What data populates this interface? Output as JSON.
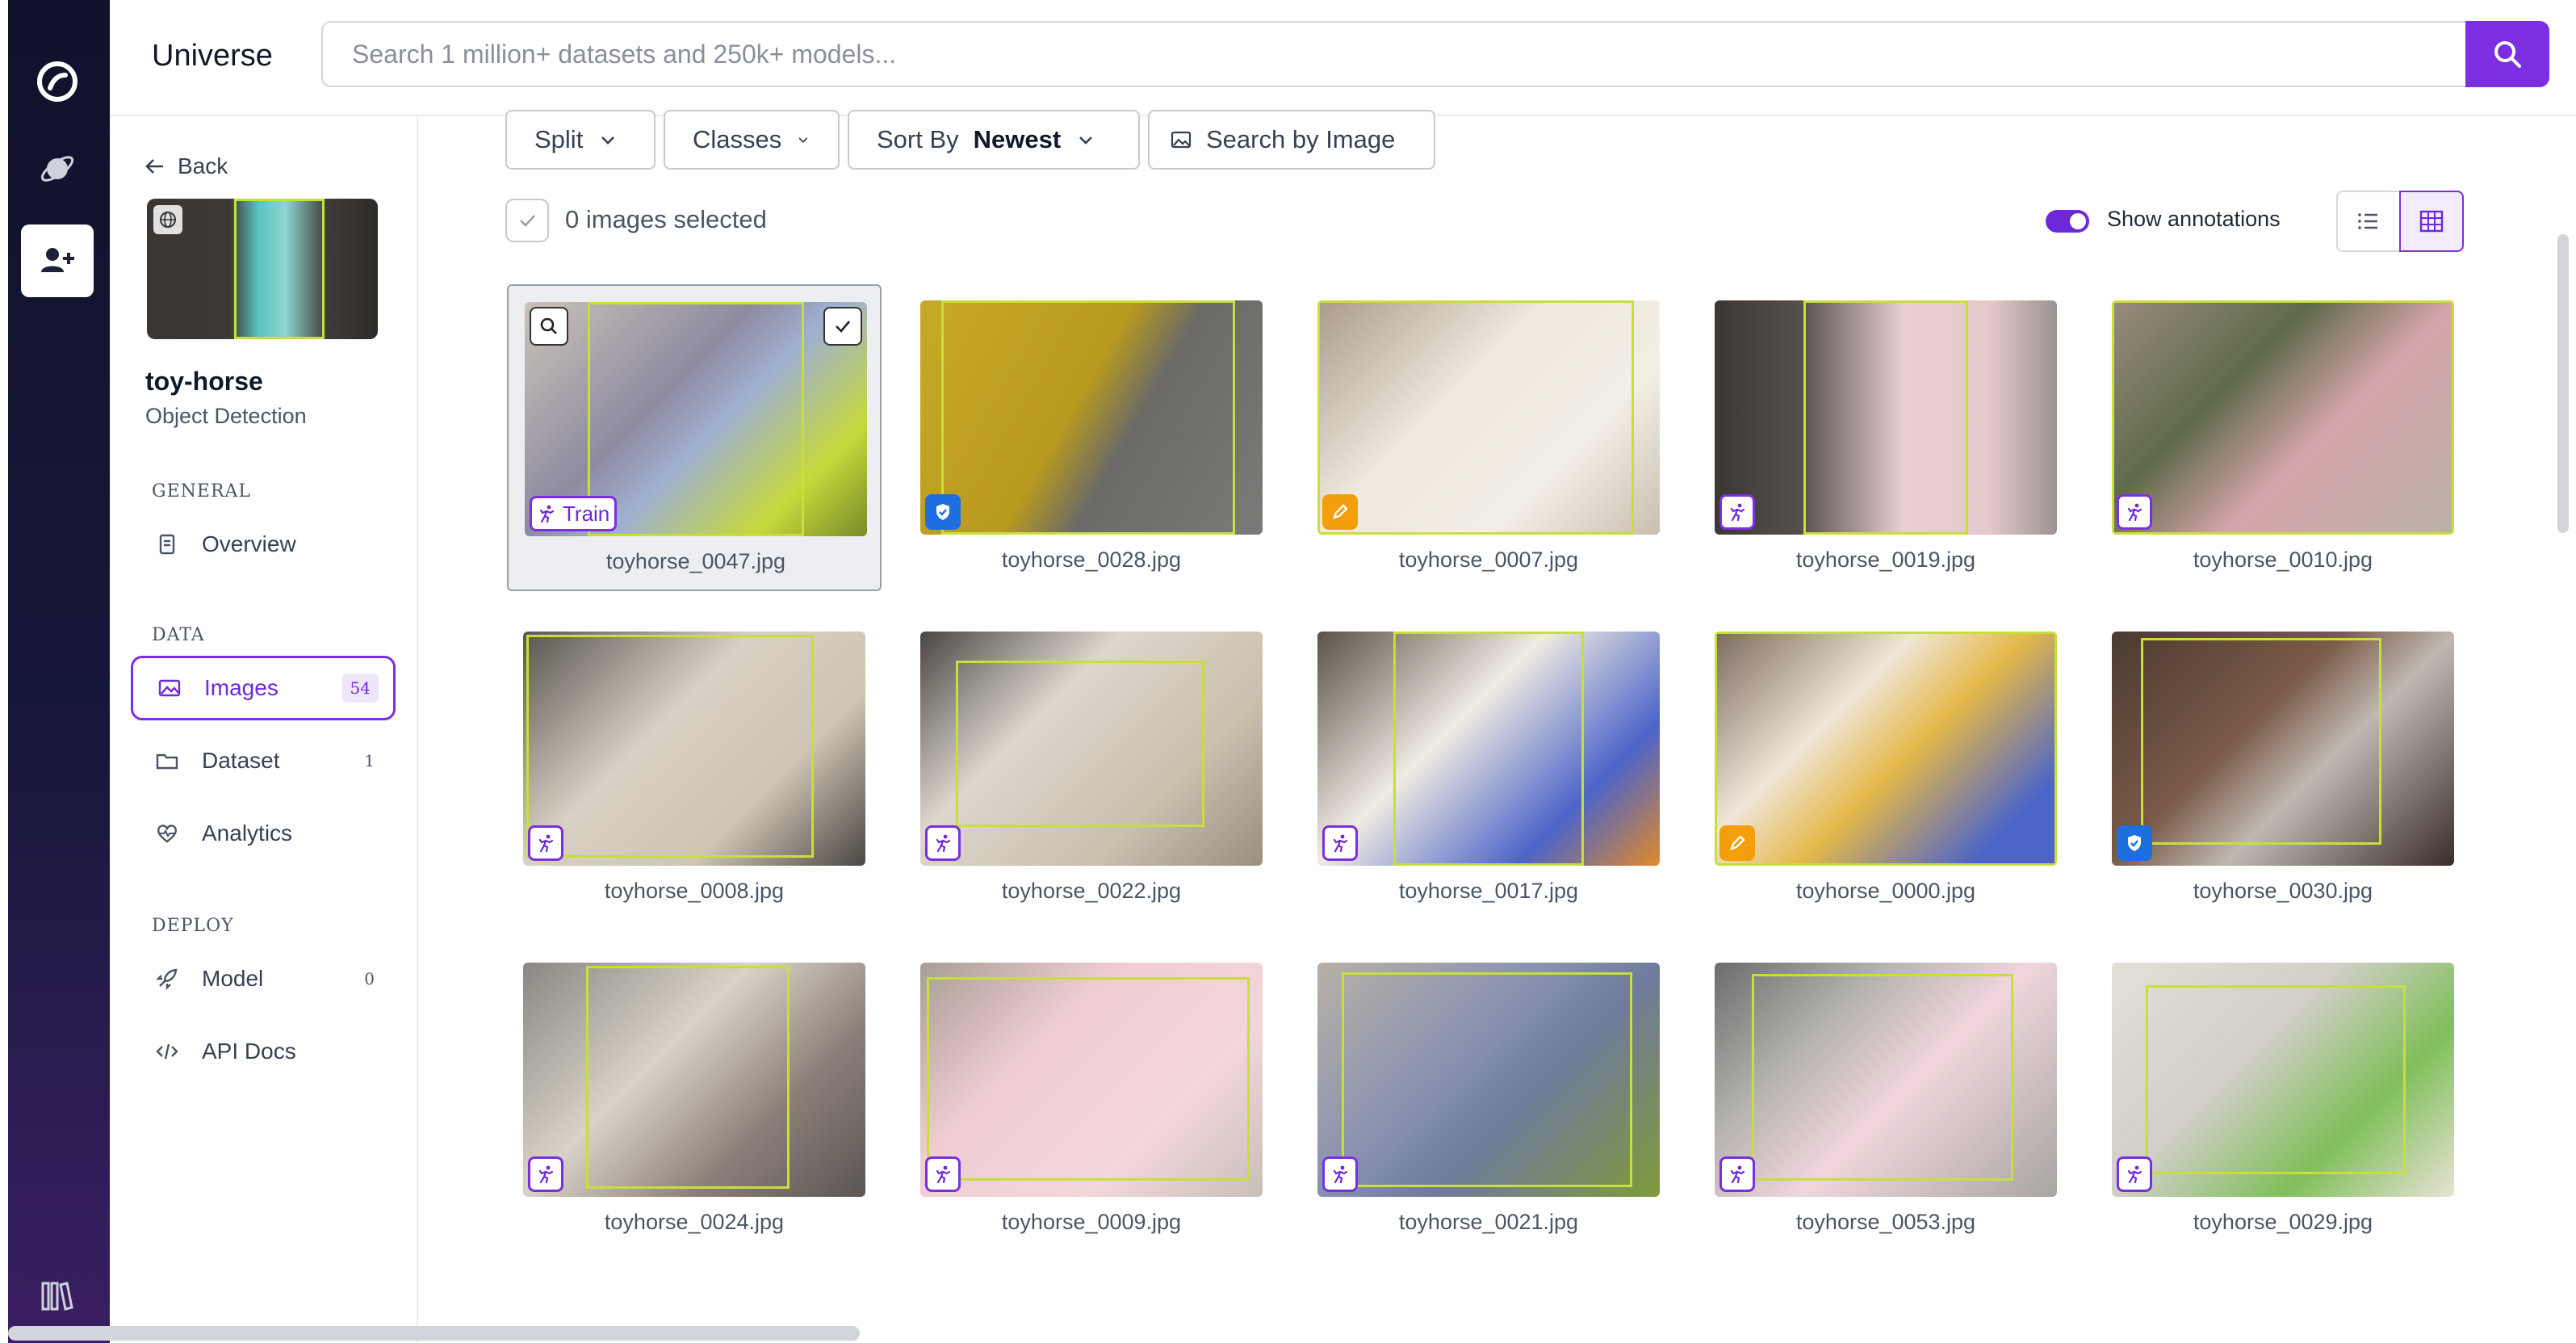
{
  "app": {
    "brand": "Universe"
  },
  "search": {
    "placeholder": "Search 1 million+ datasets and 250k+ models..."
  },
  "rail": {
    "items": [
      "roboflow-logo-icon",
      "planet-icon",
      "add-user-icon",
      "library-icon"
    ]
  },
  "sidebar": {
    "back_label": "Back",
    "project_name": "toy-horse",
    "project_type": "Object Detection",
    "sections": {
      "general": "GENERAL",
      "data": "DATA",
      "deploy": "DEPLOY"
    },
    "items": [
      {
        "id": "overview",
        "label": "Overview",
        "count": ""
      },
      {
        "id": "images",
        "label": "Images",
        "count": "54"
      },
      {
        "id": "dataset",
        "label": "Dataset",
        "count": "1"
      },
      {
        "id": "analytics",
        "label": "Analytics",
        "count": ""
      },
      {
        "id": "model",
        "label": "Model",
        "count": "0"
      },
      {
        "id": "api",
        "label": "API Docs",
        "count": ""
      }
    ]
  },
  "toolbar": {
    "split_label": "Split",
    "classes_label": "Classes",
    "sort_label": "Sort By",
    "sort_value": "Newest",
    "search_image_label": "Search by Image",
    "selected_text": "0 images selected",
    "show_annotations_label": "Show annotations"
  },
  "accent_color": "#7b2fe0",
  "bbox_color": "#c7df3b",
  "images": [
    {
      "name": "toyhorse_0047.jpg",
      "badge": "Train",
      "badge_kind": "train"
    },
    {
      "name": "toyhorse_0028.jpg",
      "badge": "",
      "badge_kind": "valid"
    },
    {
      "name": "toyhorse_0007.jpg",
      "badge": "",
      "badge_kind": "test"
    },
    {
      "name": "toyhorse_0019.jpg",
      "badge": "",
      "badge_kind": "train"
    },
    {
      "name": "toyhorse_0010.jpg",
      "badge": "",
      "badge_kind": "train"
    },
    {
      "name": "toyhorse_0008.jpg",
      "badge": "",
      "badge_kind": "train"
    },
    {
      "name": "toyhorse_0022.jpg",
      "badge": "",
      "badge_kind": "train"
    },
    {
      "name": "toyhorse_0017.jpg",
      "badge": "",
      "badge_kind": "train"
    },
    {
      "name": "toyhorse_0000.jpg",
      "badge": "",
      "badge_kind": "test"
    },
    {
      "name": "toyhorse_0030.jpg",
      "badge": "",
      "badge_kind": "valid"
    },
    {
      "name": "toyhorse_0024.jpg",
      "badge": "",
      "badge_kind": "train"
    },
    {
      "name": "toyhorse_0009.jpg",
      "badge": "",
      "badge_kind": "train"
    },
    {
      "name": "toyhorse_0021.jpg",
      "badge": "",
      "badge_kind": "train"
    },
    {
      "name": "toyhorse_0053.jpg",
      "badge": "",
      "badge_kind": "train"
    },
    {
      "name": "toyhorse_0029.jpg",
      "badge": "",
      "badge_kind": "train"
    }
  ]
}
